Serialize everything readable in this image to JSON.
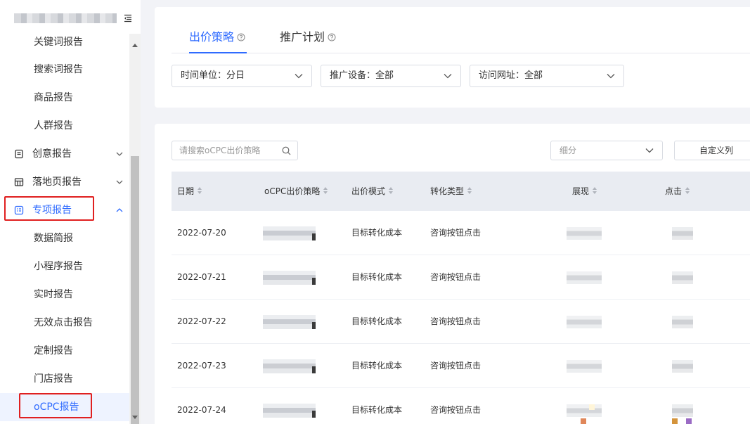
{
  "sidebar": {
    "items": [
      {
        "label": "关键词报告",
        "type": "child"
      },
      {
        "label": "搜索词报告",
        "type": "child"
      },
      {
        "label": "商品报告",
        "type": "child"
      },
      {
        "label": "人群报告",
        "type": "child"
      },
      {
        "label": "创意报告",
        "type": "parent",
        "icon": "document-icon"
      },
      {
        "label": "落地页报告",
        "type": "parent",
        "icon": "layout-icon"
      },
      {
        "label": "专项报告",
        "type": "parent",
        "icon": "special-report-icon",
        "expanded": true
      },
      {
        "label": "数据简报",
        "type": "child"
      },
      {
        "label": "小程序报告",
        "type": "child"
      },
      {
        "label": "实时报告",
        "type": "child"
      },
      {
        "label": "无效点击报告",
        "type": "child"
      },
      {
        "label": "定制报告",
        "type": "child"
      },
      {
        "label": "门店报告",
        "type": "child"
      },
      {
        "label": "oCPC报告",
        "type": "child",
        "selected": true
      }
    ]
  },
  "tabs": [
    {
      "label": "出价策略",
      "active": true
    },
    {
      "label": "推广计划",
      "active": false
    }
  ],
  "filters": {
    "time_unit": "时间单位：分日",
    "device": "推广设备：全部",
    "url": "访问网址：全部"
  },
  "toolbar": {
    "search_placeholder": "请搜索oCPC出价策略",
    "segment_placeholder": "细分",
    "custom_columns": "自定义列"
  },
  "table": {
    "columns": [
      "日期",
      "oCPC出价策略",
      "出价模式",
      "转化类型",
      "展现",
      "点击"
    ],
    "rows": [
      {
        "date": "2022-07-20",
        "bid_mode": "目标转化成本",
        "conv_type": "咨询按钮点击"
      },
      {
        "date": "2022-07-21",
        "bid_mode": "目标转化成本",
        "conv_type": "咨询按钮点击"
      },
      {
        "date": "2022-07-22",
        "bid_mode": "目标转化成本",
        "conv_type": "咨询按钮点击"
      },
      {
        "date": "2022-07-23",
        "bid_mode": "目标转化成本",
        "conv_type": "咨询按钮点击"
      },
      {
        "date": "2022-07-24",
        "bid_mode": "目标转化成本",
        "conv_type": "咨询按钮点击"
      }
    ]
  },
  "colors": {
    "accent": "#2f6bff",
    "highlight_box": "#e02020"
  }
}
